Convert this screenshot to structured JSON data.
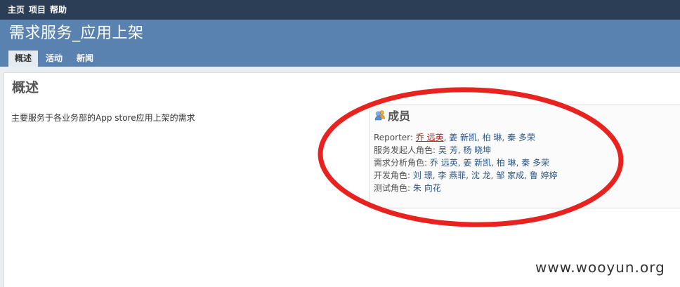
{
  "top_menu": [
    "主页",
    "项目",
    "帮助"
  ],
  "project": {
    "title": "需求服务_应用上架"
  },
  "tabs": [
    {
      "label": "概述",
      "selected": true
    },
    {
      "label": "活动",
      "selected": false
    },
    {
      "label": "新闻",
      "selected": false
    }
  ],
  "overview": {
    "heading": "概述",
    "description": "主要服务于各业务部的App store应用上架的需求"
  },
  "members": {
    "heading": "成员",
    "icon": "users-icon",
    "roles": [
      {
        "role": "Reporter",
        "users": [
          "乔 远英",
          "姜 新凯",
          "柏 琳",
          "秦 多荣"
        ],
        "highlighted_user": "乔 远英"
      },
      {
        "role": "服务发起人角色",
        "users": [
          "吴 芳",
          "杨 晓坤"
        ]
      },
      {
        "role": "需求分析角色",
        "users": [
          "乔 远英",
          "姜 新凯",
          "柏 琳",
          "秦 多荣"
        ]
      },
      {
        "role": "开发角色",
        "users": [
          "刘 璟",
          "李 燕菲",
          "沈 龙",
          "邹 家成",
          "鲁 婷婷"
        ]
      },
      {
        "role": "测试角色",
        "users": [
          "朱 向花"
        ]
      }
    ]
  },
  "annotation": {
    "shape": "ellipse",
    "color": "#e8231f"
  },
  "watermark": "www.wooyun.org",
  "colors": {
    "top_bar": "#2c3e55",
    "header": "#5a82b0",
    "link": "#2a5685",
    "highlight_link": "#b22222"
  }
}
